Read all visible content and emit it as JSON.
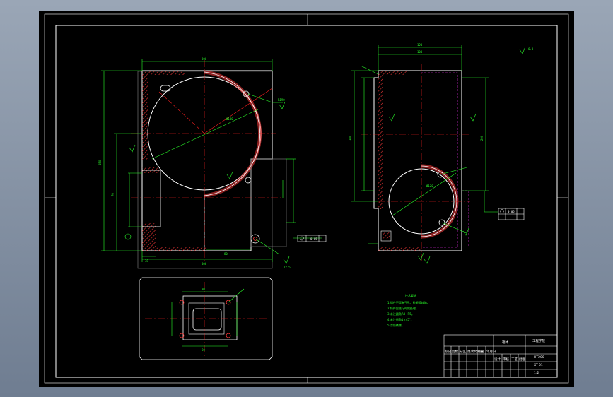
{
  "drawing": {
    "colors": {
      "background": "#000000",
      "frame": "#ffffff",
      "outline": "#ffffff",
      "center_line": "#ff2020",
      "dimension": "#2bff2b",
      "hatch": "#ff3b3b",
      "hidden": "#ff33ff",
      "workspace": "#8595aa"
    },
    "front_view": {
      "dim_top": "300",
      "dim_bottom": "400",
      "dim_left_total": "350",
      "dim_radius": "R190",
      "dim_inner": "80",
      "dim_bore": "Ø180",
      "dim_side_a": "38",
      "dim_side_b": "70",
      "tolerance_note": "0.05",
      "roughness": "12.5"
    },
    "side_view": {
      "dim_top": "120",
      "dim_top_inner": "100",
      "dim_left": "300",
      "dim_bore": "Ø120",
      "dim_right": "200",
      "tolerance_note": "0.05",
      "roughness": "6.3"
    },
    "bottom_view": {
      "dim_a": "80",
      "dim_b": "50"
    },
    "notes": {
      "title": "技术要求",
      "items": [
        "1.铸件不得有气孔、砂眼等缺陷。",
        "2.铸件应进行时效处理。",
        "3.未注圆角R3~R5。",
        "4.未注倒角1×45°。",
        "5.涂防锈漆。"
      ]
    },
    "title_block": {
      "name": "箱体",
      "material": "HT200",
      "drawing_no": "XT-01",
      "scale": "1:2",
      "org": "工程学院",
      "row_labels": [
        "标记",
        "处数",
        "分区",
        "更改文件号",
        "签名",
        "年月日"
      ],
      "footer_labels": [
        "设计",
        "审核",
        "工艺",
        "批准"
      ]
    }
  }
}
